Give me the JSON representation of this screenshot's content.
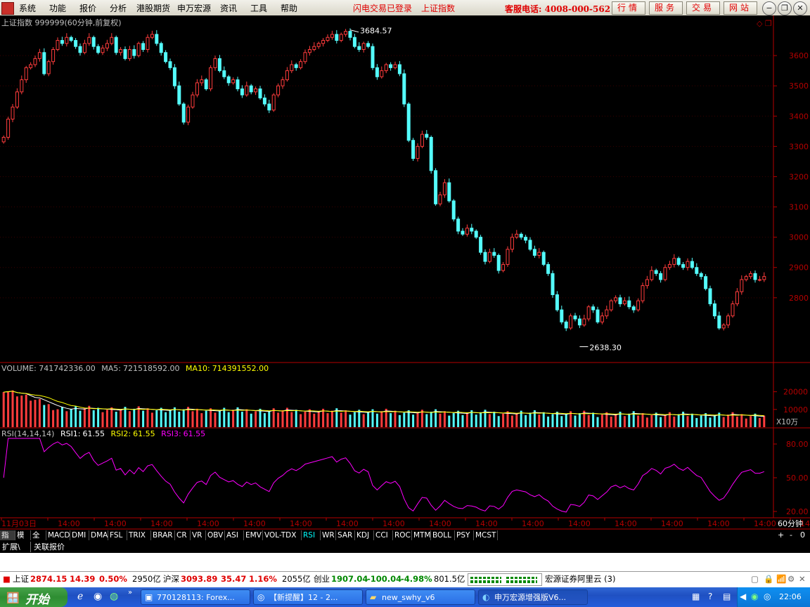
{
  "menubar": {
    "items": [
      "系统",
      "功能",
      "报价",
      "分析",
      "港股期货",
      "申万宏源",
      "资讯",
      "工具",
      "帮助"
    ],
    "notice1": "闪电交易已登录",
    "notice2": "上证指数",
    "hotline": "客服电话: 4008-000-562",
    "buttons": [
      "行情",
      "服务",
      "交易",
      "网站"
    ]
  },
  "colors": {
    "up": "#ff3c3c",
    "down": "#54fcfc",
    "axis": "#b40000",
    "ma5": "#ffffff",
    "ma10": "#ffff00",
    "rsi": "#ff00ff",
    "label": "#c0c0c0"
  },
  "chart_data": [
    {
      "type": "candlestick",
      "title": "上证指数 999999(60分钟,前复权)",
      "ylim": [
        2600,
        3700
      ],
      "yticks": [
        2800,
        2900,
        3000,
        3100,
        3200,
        3300,
        3400,
        3500,
        3600
      ],
      "annotations": [
        {
          "text": "3684.57",
          "value": 3684.57,
          "index": 77
        },
        {
          "text": "2638.30",
          "value": 2638.3,
          "index": 128
        }
      ],
      "series_type": "close_path",
      "closes": [
        3330,
        3390,
        3430,
        3480,
        3520,
        3560,
        3570,
        3590,
        3610,
        3540,
        3580,
        3620,
        3650,
        3640,
        3660,
        3650,
        3630,
        3610,
        3640,
        3660,
        3630,
        3610,
        3625,
        3640,
        3660,
        3610,
        3620,
        3590,
        3620,
        3600,
        3640,
        3620,
        3660,
        3670,
        3640,
        3610,
        3580,
        3560,
        3500,
        3440,
        3380,
        3430,
        3470,
        3510,
        3520,
        3490,
        3560,
        3590,
        3550,
        3530,
        3510,
        3520,
        3490,
        3470,
        3500,
        3480,
        3490,
        3460,
        3440,
        3420,
        3470,
        3500,
        3520,
        3550,
        3570,
        3560,
        3580,
        3610,
        3620,
        3630,
        3640,
        3650,
        3660,
        3670,
        3650,
        3670,
        3680,
        3660,
        3630,
        3620,
        3640,
        3630,
        3560,
        3530,
        3550,
        3570,
        3560,
        3570,
        3540,
        3440,
        3320,
        3260,
        3300,
        3340,
        3330,
        3220,
        3110,
        3140,
        3180,
        3120,
        3060,
        3020,
        3010,
        3030,
        3020,
        3000,
        2950,
        2920,
        2950,
        2940,
        2890,
        2910,
        2960,
        3000,
        3010,
        3000,
        2990,
        2960,
        2940,
        2950,
        2910,
        2880,
        2810,
        2760,
        2720,
        2700,
        2740,
        2730,
        2710,
        2730,
        2770,
        2760,
        2720,
        2740,
        2760,
        2790,
        2800,
        2780,
        2790,
        2770,
        2760,
        2790,
        2840,
        2860,
        2890,
        2880,
        2860,
        2900,
        2910,
        2930,
        2910,
        2900,
        2920,
        2900,
        2880,
        2870,
        2830,
        2780,
        2740,
        2700,
        2710,
        2740,
        2780,
        2820,
        2860,
        2870,
        2880,
        2860,
        2860,
        2870
      ]
    },
    {
      "type": "bar",
      "title": "VOLUME",
      "volume": "741742336.00",
      "ma5_label": "MA5:",
      "ma5": "721518592.00",
      "ma10_label": "MA10:",
      "ma10": "714391552.00",
      "unit": "X10万",
      "yticks": [
        10000,
        20000
      ],
      "ylim": [
        0,
        25000
      ]
    },
    {
      "type": "line",
      "title": "RSI(14,14,14)",
      "rsi1_label": "RSI1:",
      "rsi1": "61.55",
      "rsi2_label": "RSI2:",
      "rsi2": "61.55",
      "rsi3_label": "RSI3:",
      "rsi3": "61.55",
      "ylim": [
        15,
        85
      ],
      "yticks": [
        20,
        50,
        80
      ]
    }
  ],
  "x_axis": {
    "labels": [
      "11月03日",
      "14:00",
      "14:00",
      "14:00",
      "14:00",
      "14:00",
      "14:00",
      "14:00",
      "14:00",
      "14:00",
      "14:00",
      "14:00",
      "14:00",
      "14:00",
      "14:00",
      "14:00",
      "14:00",
      "14:00"
    ],
    "period": "60分钟",
    "plus": "+",
    "minus": "-",
    "zero": "0"
  },
  "indicator_tabs": [
    "指标",
    "模板",
    "全部",
    "MACD",
    "DMI",
    "DMA",
    "FSL",
    "TRIX",
    "BRAR",
    "CR",
    "VR",
    "OBV",
    "ASI",
    "EMV",
    "VOL-TDX",
    "RSI",
    "WR",
    "SAR",
    "KDJ",
    "CCI",
    "ROC",
    "MTM",
    "BOLL",
    "PSY",
    "MCST"
  ],
  "ext_tabs": [
    "扩展\\",
    "关联报价"
  ],
  "status": {
    "sh_name": "上证",
    "sh_value": "2874.15",
    "sh_change": "14.39",
    "sh_pct": "0.50%",
    "sh_amount": "2950亿",
    "hs_name": "沪深",
    "hs_value": "3093.89",
    "hs_change": "35.47",
    "hs_pct": "1.16%",
    "hs_amount": "2055亿",
    "cy_name": "创业",
    "cy_value": "1907.04",
    "cy_change": "-100.04",
    "cy_pct": "-4.98%",
    "cy_amount": "801.5亿",
    "broker": "宏源证券阿里云 (3)"
  },
  "taskbar": {
    "start": "开始",
    "tasks": [
      "770128113: Forex...",
      "【新提醒】12 - 2...",
      "new_swhy_v6",
      "申万宏源增强版V6..."
    ],
    "time": "22:06"
  }
}
